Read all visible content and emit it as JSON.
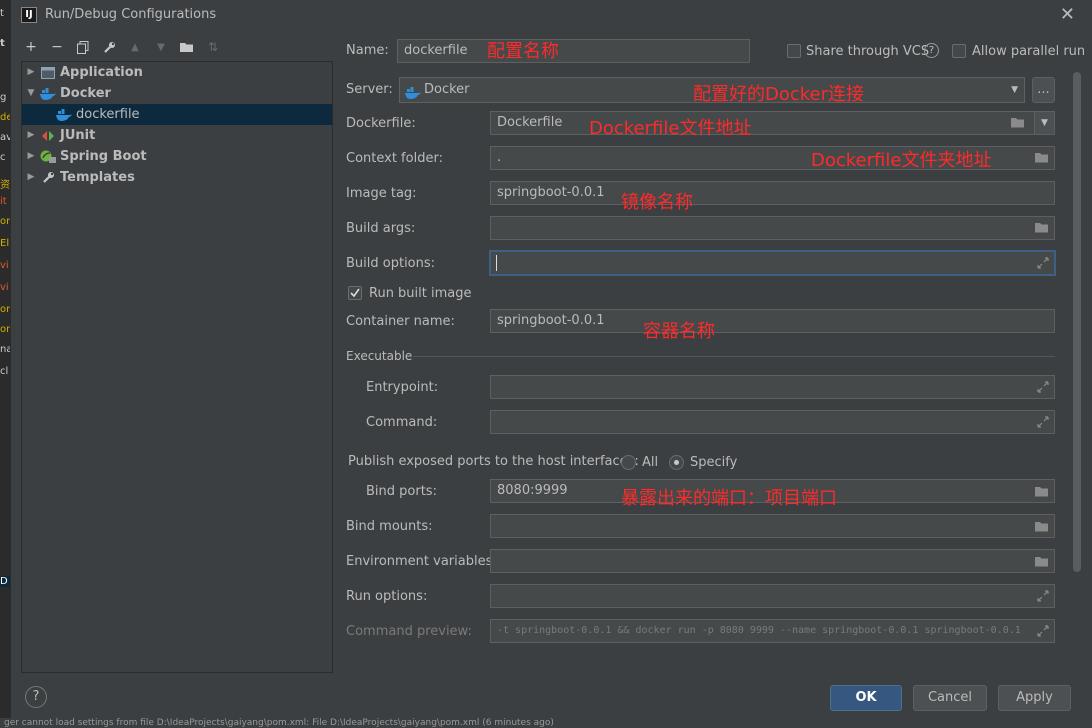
{
  "window": {
    "title": "Run/Debug Configurations",
    "app_icon": "IJ"
  },
  "toolbar": {
    "add": "+",
    "remove": "−",
    "copy": "⧉",
    "edit": "🔧",
    "up": "▲",
    "down": "▼",
    "folder": "📁",
    "sort": "⇅"
  },
  "tree": {
    "items": [
      {
        "label": "Application",
        "icon": "application-icon",
        "level": 0,
        "expanded": false
      },
      {
        "label": "Docker",
        "icon": "docker-icon",
        "level": 0,
        "expanded": true
      },
      {
        "label": "dockerfile",
        "icon": "docker-icon",
        "level": 1,
        "selected": true
      },
      {
        "label": "JUnit",
        "icon": "junit-icon",
        "level": 0,
        "expanded": false
      },
      {
        "label": "Spring Boot",
        "icon": "spring-boot-icon",
        "level": 0,
        "expanded": false
      },
      {
        "label": "Templates",
        "icon": "wrench-icon",
        "level": 0,
        "expanded": false
      }
    ]
  },
  "form": {
    "name_label": "Name:",
    "name_value": "dockerfile",
    "share_label": "Share through VCS",
    "parallel_label": "Allow parallel run",
    "server_label": "Server:",
    "server_value": "Docker",
    "server_more": "...",
    "dockerfile_label": "Dockerfile:",
    "dockerfile_value": "Dockerfile",
    "context_label": "Context folder:",
    "context_value": ".",
    "image_tag_label": "Image tag:",
    "image_tag_value": "springboot-0.0.1",
    "build_args_label": "Build args:",
    "build_args_value": "",
    "build_options_label": "Build options:",
    "build_options_value": "",
    "run_built_label": "Run built image",
    "container_label": "Container name:",
    "container_value": "springboot-0.0.1",
    "executable_label": "Executable",
    "entrypoint_label": "Entrypoint:",
    "command_label": "Command:",
    "publish_label": "Publish exposed ports to the host interfaces:",
    "all_label": "All",
    "specify_label": "Specify",
    "bind_ports_label": "Bind ports:",
    "bind_ports_value": "8080:9999",
    "bind_mounts_label": "Bind mounts:",
    "env_label": "Environment variables:",
    "run_options_label": "Run options:",
    "preview_label": "Command preview:",
    "preview_value": "-t springboot-0.0.1  && docker run -p 8080 9999 --name springboot-0.0.1 springboot-0.0.1"
  },
  "annotations": {
    "name": "配置名称",
    "server": "配置好的Docker连接",
    "dockerfile": "Dockerfile文件地址",
    "context": "Dockerfile文件夹地址",
    "image": "镜像名称",
    "container": "容器名称",
    "ports": "暴露出来的端口：项目端口"
  },
  "buttons": {
    "ok": "OK",
    "cancel": "Cancel",
    "apply": "Apply",
    "help": "?"
  },
  "statusbar": "ger cannot load settings from file D:\\IdeaProjects\\gaiyang\\pom.xml: File D:\\IdeaProjects\\gaiyang\\pom.xml (6 minutes ago)",
  "colors": {
    "accent": "#365880",
    "annotation": "#ff2a2a",
    "selection": "#0d293e",
    "docker": "#2f8fdc"
  }
}
